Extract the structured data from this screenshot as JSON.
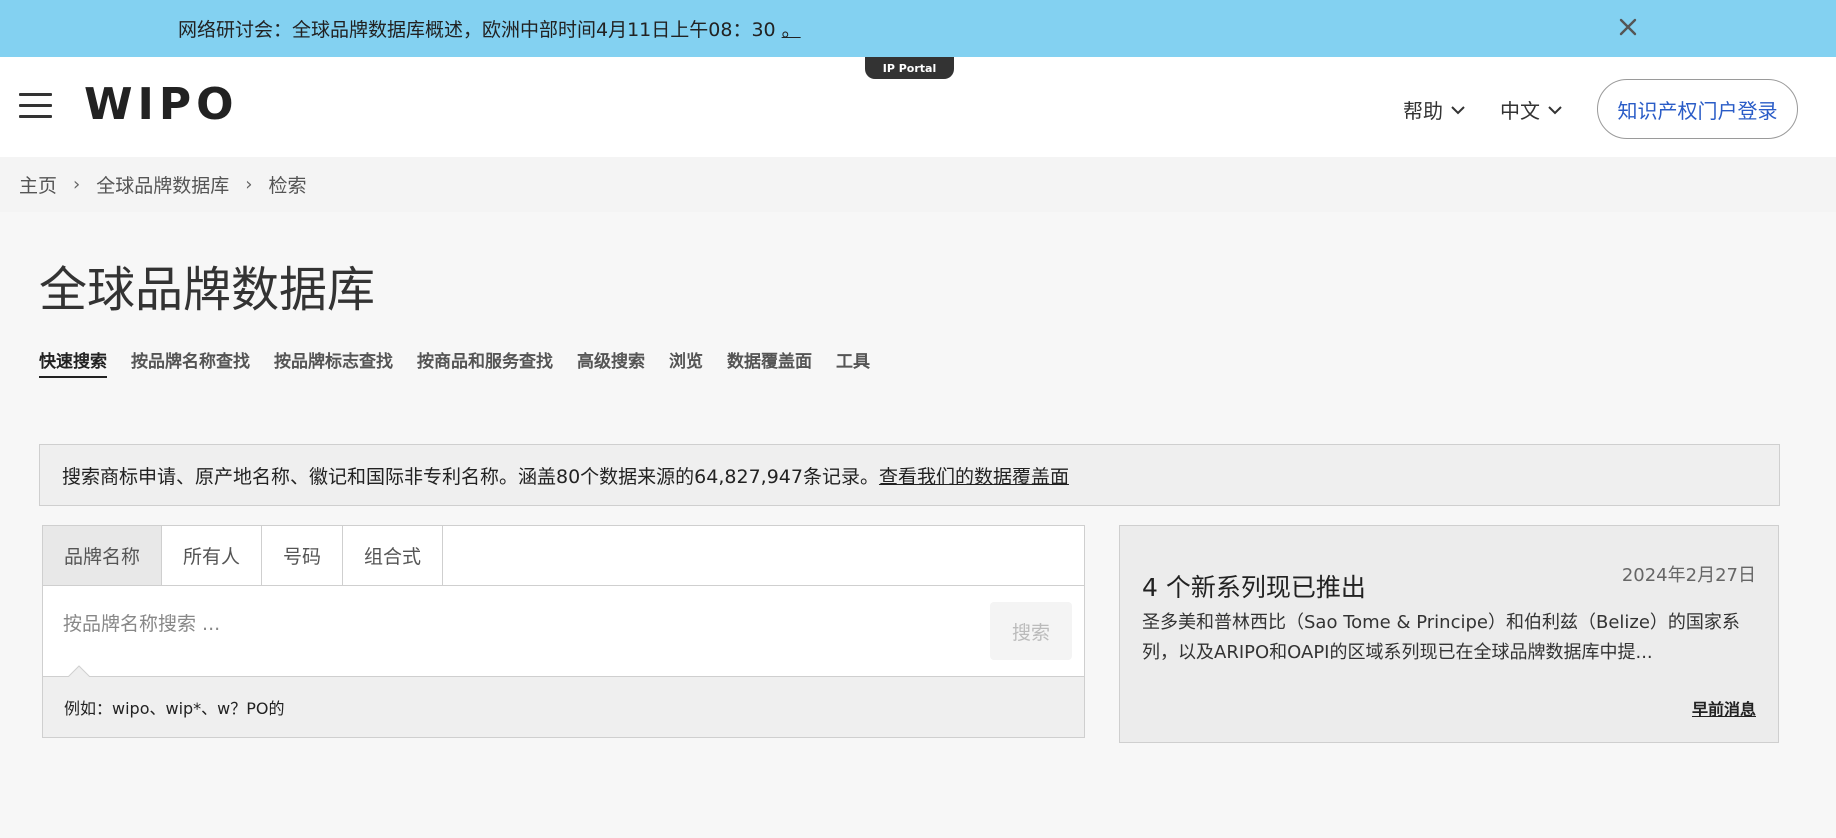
{
  "banner": {
    "text": "网络研讨会：全球品牌数据库概述，欧洲中部时间4月11日上午08：30",
    "link_text": "。"
  },
  "header": {
    "portal_tag": "IP Portal",
    "logo": "WIPO",
    "help_label": "帮助",
    "language_label": "中文",
    "login_label": "知识产权门户登录"
  },
  "breadcrumb": {
    "items": [
      "主页",
      "全球品牌数据库",
      "检索"
    ]
  },
  "page": {
    "title": "全球品牌数据库"
  },
  "tabs": [
    {
      "label": "快速搜索",
      "active": true
    },
    {
      "label": "按品牌名称查找"
    },
    {
      "label": "按品牌标志查找"
    },
    {
      "label": "按商品和服务查找"
    },
    {
      "label": "高级搜索"
    },
    {
      "label": "浏览"
    },
    {
      "label": "数据覆盖面"
    },
    {
      "label": "工具"
    }
  ],
  "info": {
    "text": "搜索商标申请、原产地名称、徽记和国际非专利名称。涵盖80个数据来源的64,827,947条记录。",
    "link": "查看我们的数据覆盖面"
  },
  "search": {
    "tabs": [
      "品牌名称",
      "所有人",
      "号码",
      "组合式"
    ],
    "placeholder": "按品牌名称搜索 ...",
    "button_label": "搜索",
    "hint": "例如：wipo、wip*、w？PO的"
  },
  "news": {
    "title": "4 个新系列现已推出",
    "date": "2024年2月27日",
    "body": "圣多美和普林西比（Sao Tome & Principe）和伯利兹（Belize）的国家系列，以及ARIPO和OAPI的区域系列现已在全球品牌数据库中提...",
    "link": "早前消息"
  },
  "colors": {
    "banner_bg": "#83d1f1",
    "login_text": "#2a5cc7"
  }
}
